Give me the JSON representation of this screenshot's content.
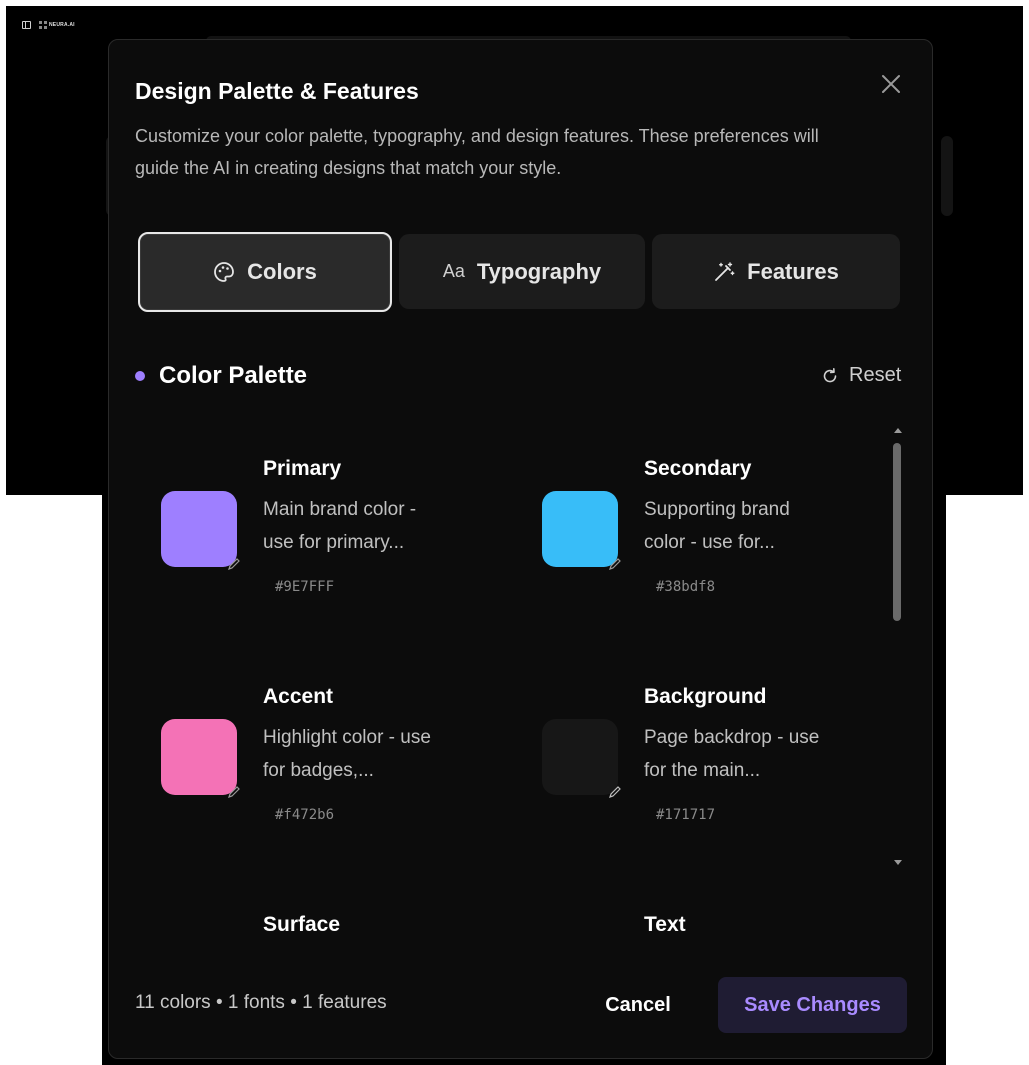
{
  "background": {
    "brand": "NEURA.AI"
  },
  "modal": {
    "title": "Design Palette & Features",
    "description": "Customize your color palette, typography, and design features. These preferences will guide the AI in creating designs that match your style.",
    "tabs": [
      {
        "label": "Colors",
        "icon": "palette-icon",
        "active": true
      },
      {
        "label": "Typography",
        "icon": "aa",
        "active": false
      },
      {
        "label": "Features",
        "icon": "magic-wand-icon",
        "active": false
      }
    ],
    "section": {
      "title": "Color Palette",
      "accent": "#9E7FFF",
      "reset_label": "Reset"
    },
    "colors": [
      {
        "name": "Primary",
        "desc_line1": "Main brand color -",
        "desc_line2": "use for primary...",
        "hex": "#9E7FFF"
      },
      {
        "name": "Secondary",
        "desc_line1": "Supporting brand",
        "desc_line2": "color - use for...",
        "hex": "#38bdf8"
      },
      {
        "name": "Accent",
        "desc_line1": "Highlight color - use",
        "desc_line2": "for badges,...",
        "hex": "#f472b6"
      },
      {
        "name": "Background",
        "desc_line1": "Page backdrop - use",
        "desc_line2": "for the main...",
        "hex": "#171717"
      },
      {
        "name": "Surface"
      },
      {
        "name": "Text"
      }
    ],
    "footer": {
      "summary": "11 colors • 1 fonts • 1 features",
      "cancel_label": "Cancel",
      "save_label": "Save Changes"
    }
  }
}
